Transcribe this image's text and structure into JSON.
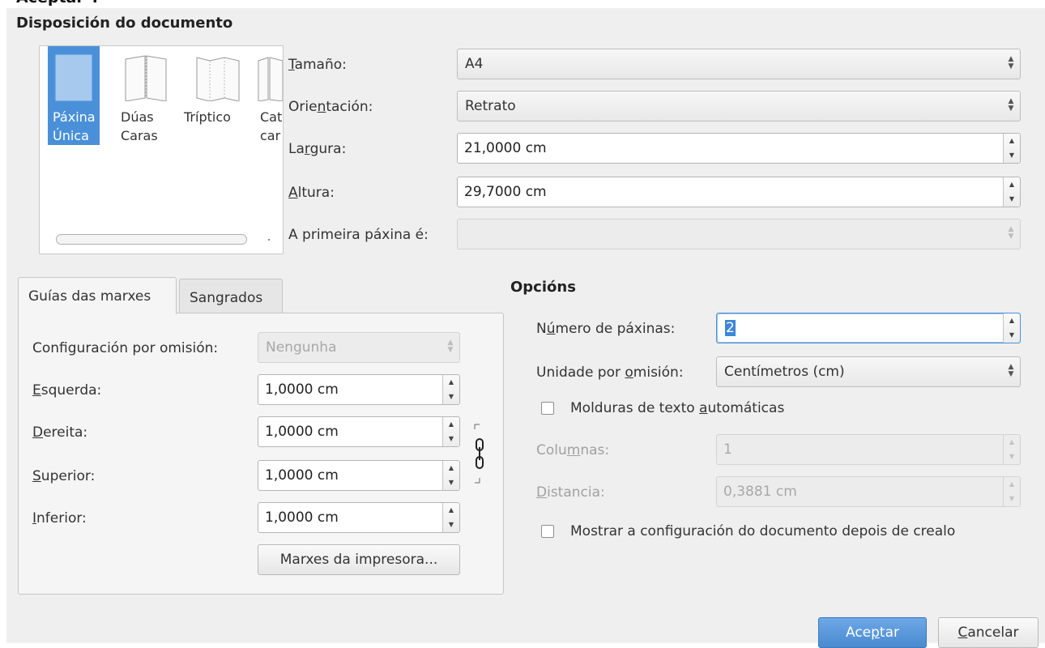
{
  "window": {
    "cut_title": "Aceptar\".",
    "section_layout_title": "Disposición do documento",
    "section_options_title": "Opcións"
  },
  "layouts": [
    {
      "line1": "Páxina",
      "line2": "Única",
      "selected": true
    },
    {
      "line1": "Dúas",
      "line2": "Caras",
      "selected": false
    },
    {
      "line1": "Tríptico",
      "line2": "",
      "selected": false
    },
    {
      "line1": "Cat",
      "line2": "car",
      "selected": false
    }
  ],
  "fields": {
    "size": {
      "label_pre": "",
      "label_u": "T",
      "label_post": "amaño:",
      "value": "A4"
    },
    "orientation": {
      "label_pre": "Orie",
      "label_u": "n",
      "label_post": "tación:",
      "value": "Retrato"
    },
    "width": {
      "label_pre": "La",
      "label_u": "r",
      "label_post": "gura:",
      "value": "21,0000 cm"
    },
    "height": {
      "label_pre": "",
      "label_u": "A",
      "label_post": "ltura:",
      "value": "29,7000 cm"
    },
    "first_page": {
      "label": "A primeira páxina é:",
      "value": ""
    }
  },
  "tabs": [
    {
      "label": "Guías das marxes",
      "active": true
    },
    {
      "label": "Sangrados",
      "active": false
    }
  ],
  "margins": {
    "preset_label": "Configuración por omisión:",
    "preset_value": "Nengunha",
    "left": {
      "label_u": "E",
      "label_post": "squerda:",
      "value": "1,0000 cm"
    },
    "right": {
      "label_u": "D",
      "label_post": "ereita:",
      "value": "1,0000 cm"
    },
    "top": {
      "label_u": "S",
      "label_post": "uperior:",
      "value": "1,0000 cm"
    },
    "bottom": {
      "label_u": "I",
      "label_post": "nferior:",
      "value": "1,0000 cm"
    },
    "printer_button": "Marxes da impresora..."
  },
  "options": {
    "pages": {
      "label_pre": "N",
      "label_u": "ú",
      "label_post": "mero de páxinas:",
      "value": "2"
    },
    "unit": {
      "label_pre": "Unidade por ",
      "label_u": "o",
      "label_post": "misión:",
      "value": "Centímetros (cm)"
    },
    "auto_frames": {
      "label_pre": "Molduras de texto ",
      "label_u": "a",
      "label_post": "utomáticas",
      "checked": false
    },
    "columns": {
      "label_pre": "Colu",
      "label_u": "m",
      "label_post": "nas:",
      "value": "1"
    },
    "spacing": {
      "label_pre": "",
      "label_u": "D",
      "label_post": "istancia:",
      "value": "0,3881 cm"
    },
    "show_settings": {
      "label": "Mostrar a configuración do documento depois de crealo",
      "checked": false
    }
  },
  "buttons": {
    "ok_pre": "Ace",
    "ok_u": "p",
    "ok_post": "tar",
    "cancel_u": "C",
    "cancel_post": "ancelar"
  },
  "colors": {
    "accent": "#4a90d9",
    "dialog_bg": "#efefef"
  }
}
